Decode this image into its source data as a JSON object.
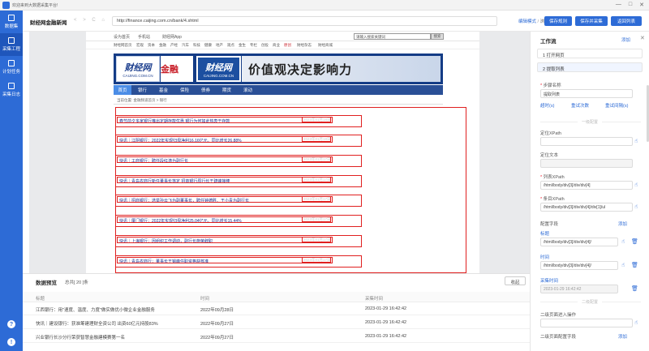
{
  "titlebar": {
    "title": "欢迎来到大数据采集平台!",
    "minimize": "—",
    "maximize": "□",
    "close": "✕"
  },
  "sidebar": {
    "items": [
      {
        "label": "数据集",
        "icon": "database-icon"
      },
      {
        "label": "采集工程",
        "icon": "project-icon"
      },
      {
        "label": "计划任务",
        "icon": "calendar-icon"
      },
      {
        "label": "采集日志",
        "icon": "log-icon"
      }
    ],
    "help": "?",
    "user": "!"
  },
  "toolbar": {
    "site_name": "财经网金融新闻",
    "back": "<",
    "forward": ">",
    "reload": "C",
    "home": "⌂",
    "url": "http://finance.caijing.com.cn/bank/4.shtml",
    "edit_mode": "编辑模式",
    "mode_sep": "/",
    "browse_mode": "浏览模式",
    "save_rule": "保存规则",
    "save_collect": "保存并采集",
    "back_list": "返回列表"
  },
  "site": {
    "topnav": [
      "设为首页",
      "手机站",
      "财经网App"
    ],
    "search_placeholder": "请输入搜索关键词",
    "search_btn": "搜索",
    "channels": [
      "财经网首页",
      "宏观",
      "资本",
      "金融",
      "产经",
      "汽车",
      "科技",
      "健康",
      "地产",
      "观点",
      "金生",
      "专栏",
      "创投",
      "商业",
      "原创",
      "财经杂志",
      "财经商城"
    ],
    "logo_text": "财经网",
    "logo_sub": "CAIJING.COM.CN",
    "jinrong": "金融",
    "slogan": "价值观决定影响力",
    "secnav": [
      "首页",
      "银行",
      "基金",
      "保险",
      "债券",
      "期货",
      "滚动"
    ],
    "crumb_label": "当前位置:",
    "crumb_home": "金融频道首页",
    "crumb_sep": ">",
    "crumb_bank": "银行",
    "news": [
      {
        "title": "春节前夕多家银行推出定期存款优惠 银行为何如此热衷于存款",
        "date": "2023年01月18日"
      },
      {
        "title": "快讯｜江阴银行：2022年实现归母净利16.16亿元，同比增长26.88%",
        "date": "2023年01月18日"
      },
      {
        "title": "快讯｜工商银行：聘任段红涛为副行长",
        "date": "2023年01月17日"
      },
      {
        "title": "快讯｜青岛农商行新任董事长落定 招商银行原行长王建峰接棒",
        "date": "2023年01月17日"
      },
      {
        "title": "快讯｜招商银行：选举孙云飞为副董事长，聘任钟德胜、王小青为副行长",
        "date": "2023年01月17日"
      },
      {
        "title": "快讯｜厦门银行：2022年实现归母净利25.04亿元，同比增长15.44%",
        "date": "2023年01月17日"
      },
      {
        "title": "快讯｜上海银行：因组织工作调动，副行长施荣辞职",
        "date": "2023年01月17日"
      },
      {
        "title": "快讯｜青岛农商行：董事长王锡峰任职资格获核准",
        "date": "2023年01月17日"
      }
    ]
  },
  "preview": {
    "title": "数据预览",
    "total": "总共[ 20 ]条",
    "fold": "收起",
    "columns": [
      "标题",
      "时间",
      "采集时间"
    ],
    "rows": [
      [
        "江西银行：用\"速度、温度、力度\"做实做优小微企业金融服务",
        "2022年09月28日",
        "2023-01-29 16:42:42"
      ],
      [
        "快讯｜建设银行：获准筹建理财全资公司 出资60亿元持股83%",
        "2022年09月27日",
        "2023-01-29 16:42:42"
      ],
      [
        "兴业银行长沙分行荣获智慧金融建模赛第一名",
        "2022年09月27日",
        "2023-01-29 16:42:42"
      ]
    ]
  },
  "panel": {
    "title": "工作流",
    "add": "添加",
    "close": "✕",
    "steps": [
      {
        "num": "1",
        "label": "打开网页"
      },
      {
        "num": "2",
        "label": "提取列表"
      }
    ],
    "step_name_label": "步骤名称",
    "step_name_value": "提取列表",
    "timeout_label": "超时(s)",
    "retry_label": "重试次数",
    "retry_interval_label": "重试间隔(s)",
    "section1": "一级配置",
    "locate_xpath_label": "定位XPath",
    "locate_text_label": "定位文本",
    "list_xpath_label": "列表XPath",
    "list_xpath_value": "/html/body/div[3]/div/div[4]",
    "item_xpath_label": "条目XPath",
    "item_xpath_value": "/html/body/div[3]/div/div[4]/div[1]/ul",
    "fields_label": "配置字段",
    "fields_add": "添加",
    "field_title_label": "标题",
    "field_title_value": "/html/body/div[3]/div/div[4]/",
    "field_time_label": "时间",
    "field_time_value": "/html/body/div[3]/div/div[4]/",
    "collect_time_label": "采集时间",
    "collect_time_value": "2023-01-29 16:42:42",
    "section2": "二级配置",
    "second_jump_label": "二级页面进入操作",
    "second_fields_label": "二级页面配置字段",
    "second_add": "添加"
  },
  "colors": {
    "accent": "#2d6bd6",
    "highlight": "#e02020",
    "banner": "#143c86"
  }
}
